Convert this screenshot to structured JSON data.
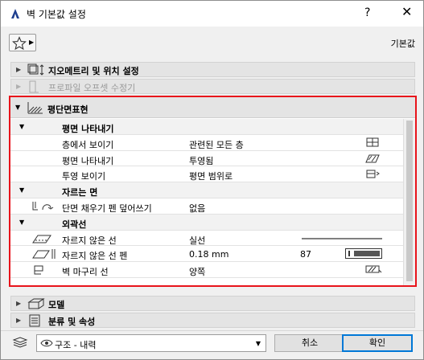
{
  "window": {
    "title": "벽 기본값 설정",
    "help_label": "?",
    "close_label": "✕"
  },
  "favorites": {
    "default_label": "기본값"
  },
  "panels": {
    "geometry": "지오메트리 및 위치 설정",
    "profile_offset": "프로파일 오프셋 수정기",
    "floor_plan": "평단면표현",
    "model": "모델",
    "classification": "분류 및 속성"
  },
  "floor_plan_section": {
    "group_display": "평면 나타내기",
    "show_on_stories_label": "층에서 보이기",
    "show_on_stories_value": "관련된 모든 층",
    "floor_plan_display_label": "평면 나타내기",
    "floor_plan_display_value": "투영됨",
    "projection_label": "투영 보이기",
    "projection_value": "평면 범위로",
    "group_cut": "자르는 면",
    "cut_fill_pen_label": "단면 채우기 펜 덮어쓰기",
    "cut_fill_pen_value": "없음",
    "group_outline": "외곽선",
    "uncut_lines_label": "자르지 않은 선",
    "uncut_lines_value": "실선",
    "uncut_line_pen_label": "자르지 않은 선 펜",
    "uncut_line_pen_value": "0.18 mm",
    "uncut_line_pen_number": "87",
    "wall_end_lines_label": "벽 마구리 선",
    "wall_end_lines_value": "양쪽"
  },
  "bottom": {
    "layer_value": "구조 - 내력",
    "cancel_label": "취소",
    "ok_label": "확인"
  },
  "colors": {
    "highlight_border": "#e8141b",
    "ok_border": "#0078d7"
  }
}
